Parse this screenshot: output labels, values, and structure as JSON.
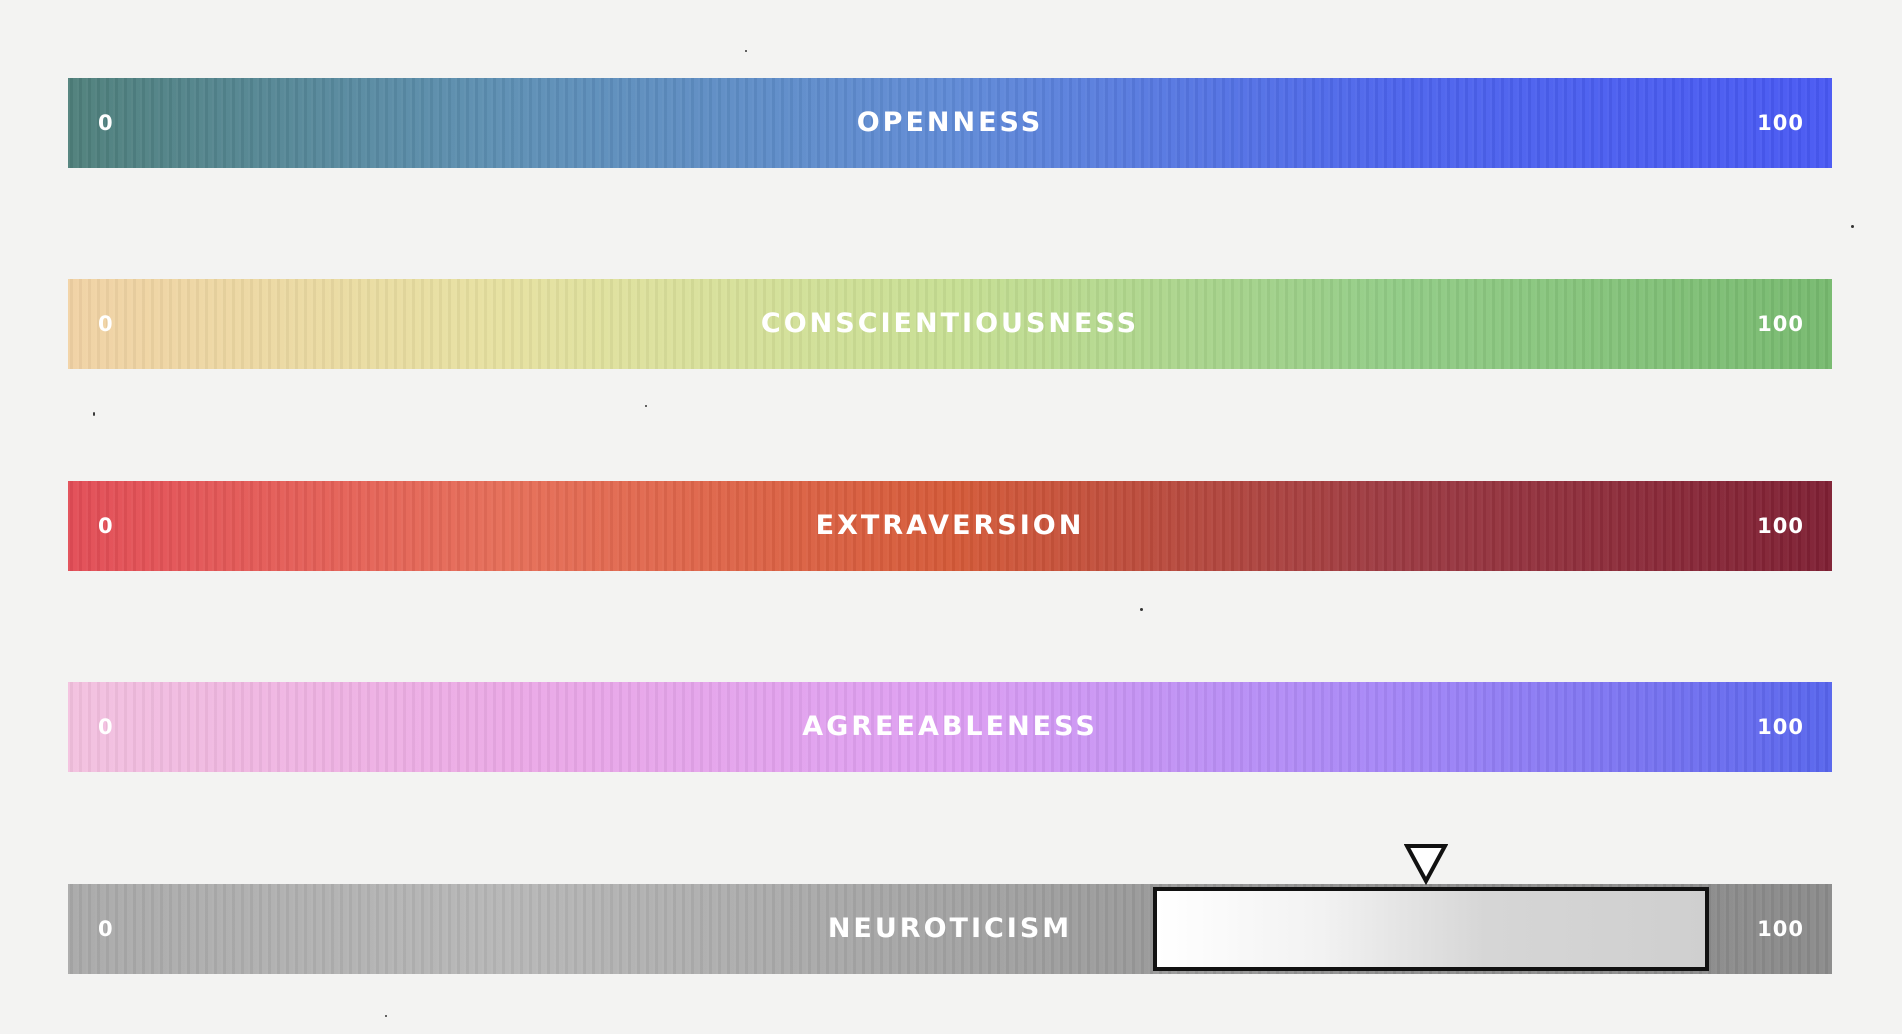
{
  "scale": {
    "min_label": "0",
    "max_label": "100"
  },
  "traits": [
    {
      "name": "OPENNESS",
      "gradient": [
        "#4e7f7a",
        "#5d8fb4",
        "#5f8ad6",
        "#4d64ec",
        "#4858f3"
      ]
    },
    {
      "name": "CONSCIENTIOUSNESS",
      "gradient": [
        "#f1d2a4",
        "#e6e1a0",
        "#c7df93",
        "#92cc86",
        "#76b96e"
      ]
    },
    {
      "name": "EXTRAVERSION",
      "gradient": [
        "#e24c56",
        "#e66e58",
        "#d55a38",
        "#9c3a42",
        "#7e1f33"
      ]
    },
    {
      "name": "AGREEABLENESS",
      "gradient": [
        "#f3c1df",
        "#eba9e6",
        "#dd9ef2",
        "#a586f7",
        "#5664ec"
      ]
    },
    {
      "name": "NEUROTICISM",
      "gradient": [
        "#a9a9a9",
        "#b7b7b7",
        "#a3a3a3",
        "#8e8e8e",
        "#8a8a8a"
      ],
      "highlight_range": [
        61.5,
        93
      ],
      "marker_value": 77
    }
  ]
}
